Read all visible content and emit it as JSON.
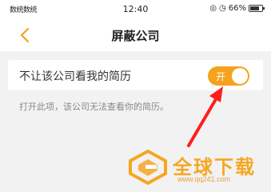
{
  "status_bar": {
    "carrier": "数统数统",
    "time": "12:40",
    "battery_percent": "66%",
    "icons": [
      "alarm-icon",
      "clock-icon",
      "battery-icon"
    ]
  },
  "nav": {
    "back_icon": "chevron-left-icon",
    "title": "屏蔽公司"
  },
  "setting": {
    "label": "不让该公司看我的简历",
    "toggle_text": "开",
    "toggle_on": true,
    "hint": "打开此项，该公司无法查看你的简历。"
  },
  "watermark": {
    "title": "全球下载",
    "url": "www.qq241.com"
  },
  "colors": {
    "accent": "#f5a21d",
    "arrow": "#ff1e1e",
    "background": "#f2f2f2"
  }
}
